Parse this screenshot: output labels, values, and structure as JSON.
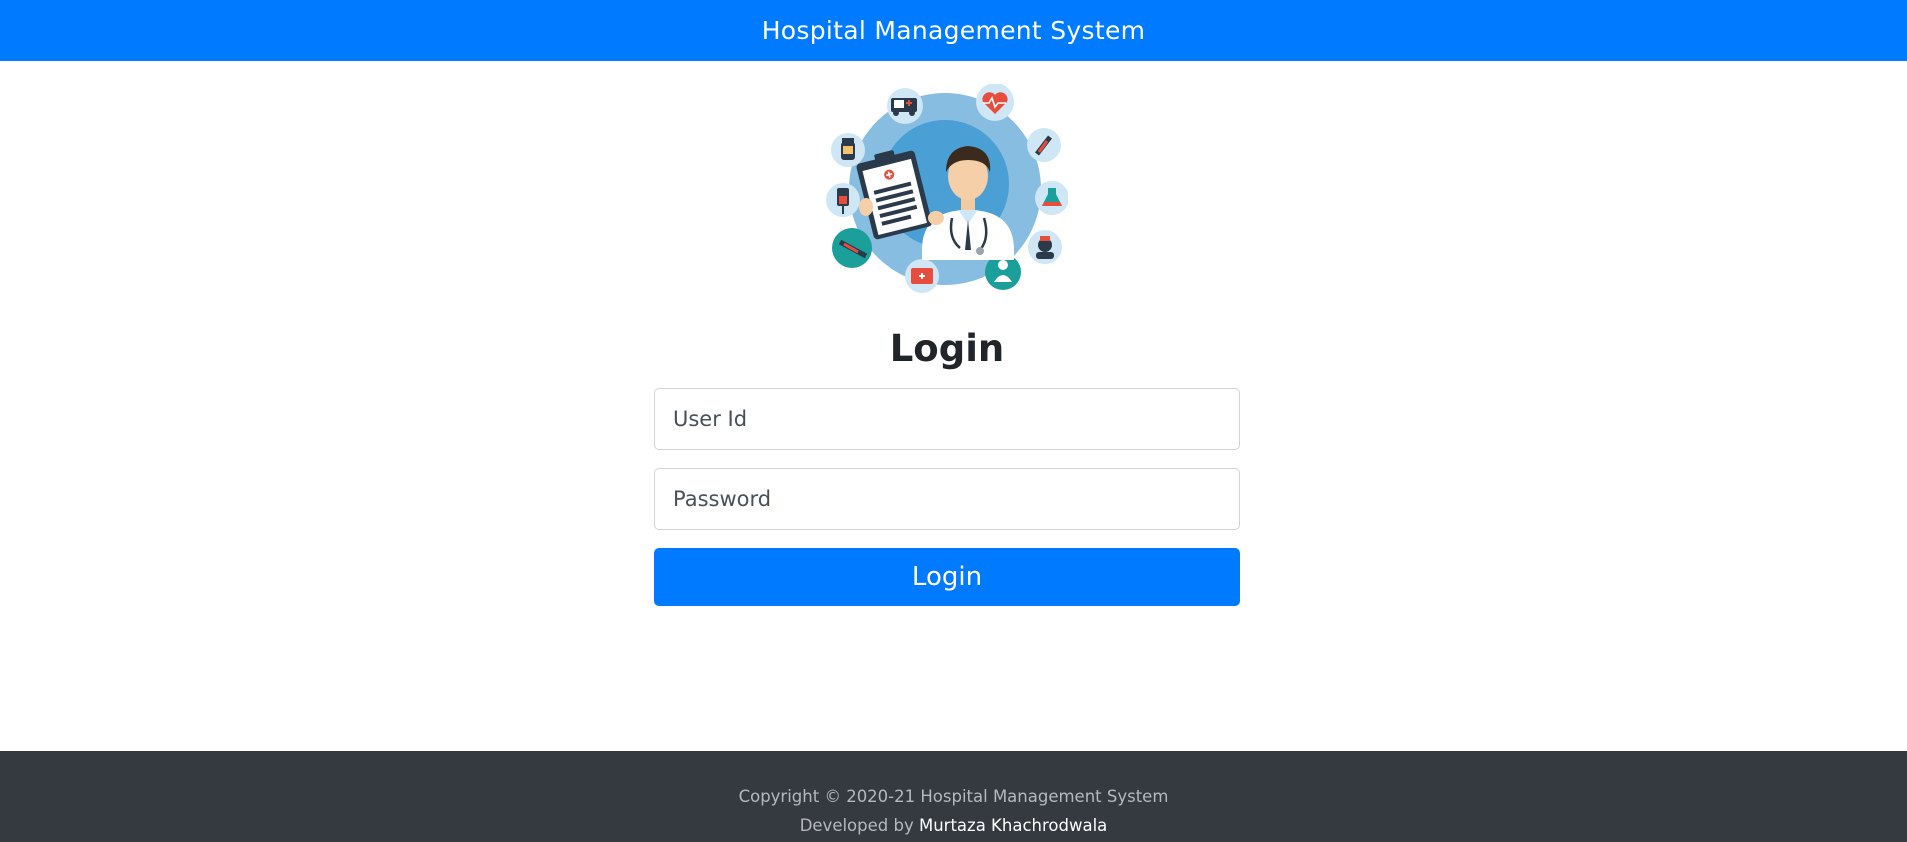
{
  "header": {
    "title": "Hospital Management System"
  },
  "logo": {
    "icon": "doctor-illustration-icon"
  },
  "login": {
    "heading": "Login",
    "user_placeholder": "User Id",
    "password_placeholder": "Password",
    "button_label": "Login"
  },
  "footer": {
    "copyright": "Copyright © 2020-21 Hospital Management System",
    "developed_prefix": "Developed by ",
    "developer_name": "Murtaza Khachrodwala"
  },
  "colors": {
    "primary": "#007bff",
    "footer_bg": "#343a40"
  }
}
